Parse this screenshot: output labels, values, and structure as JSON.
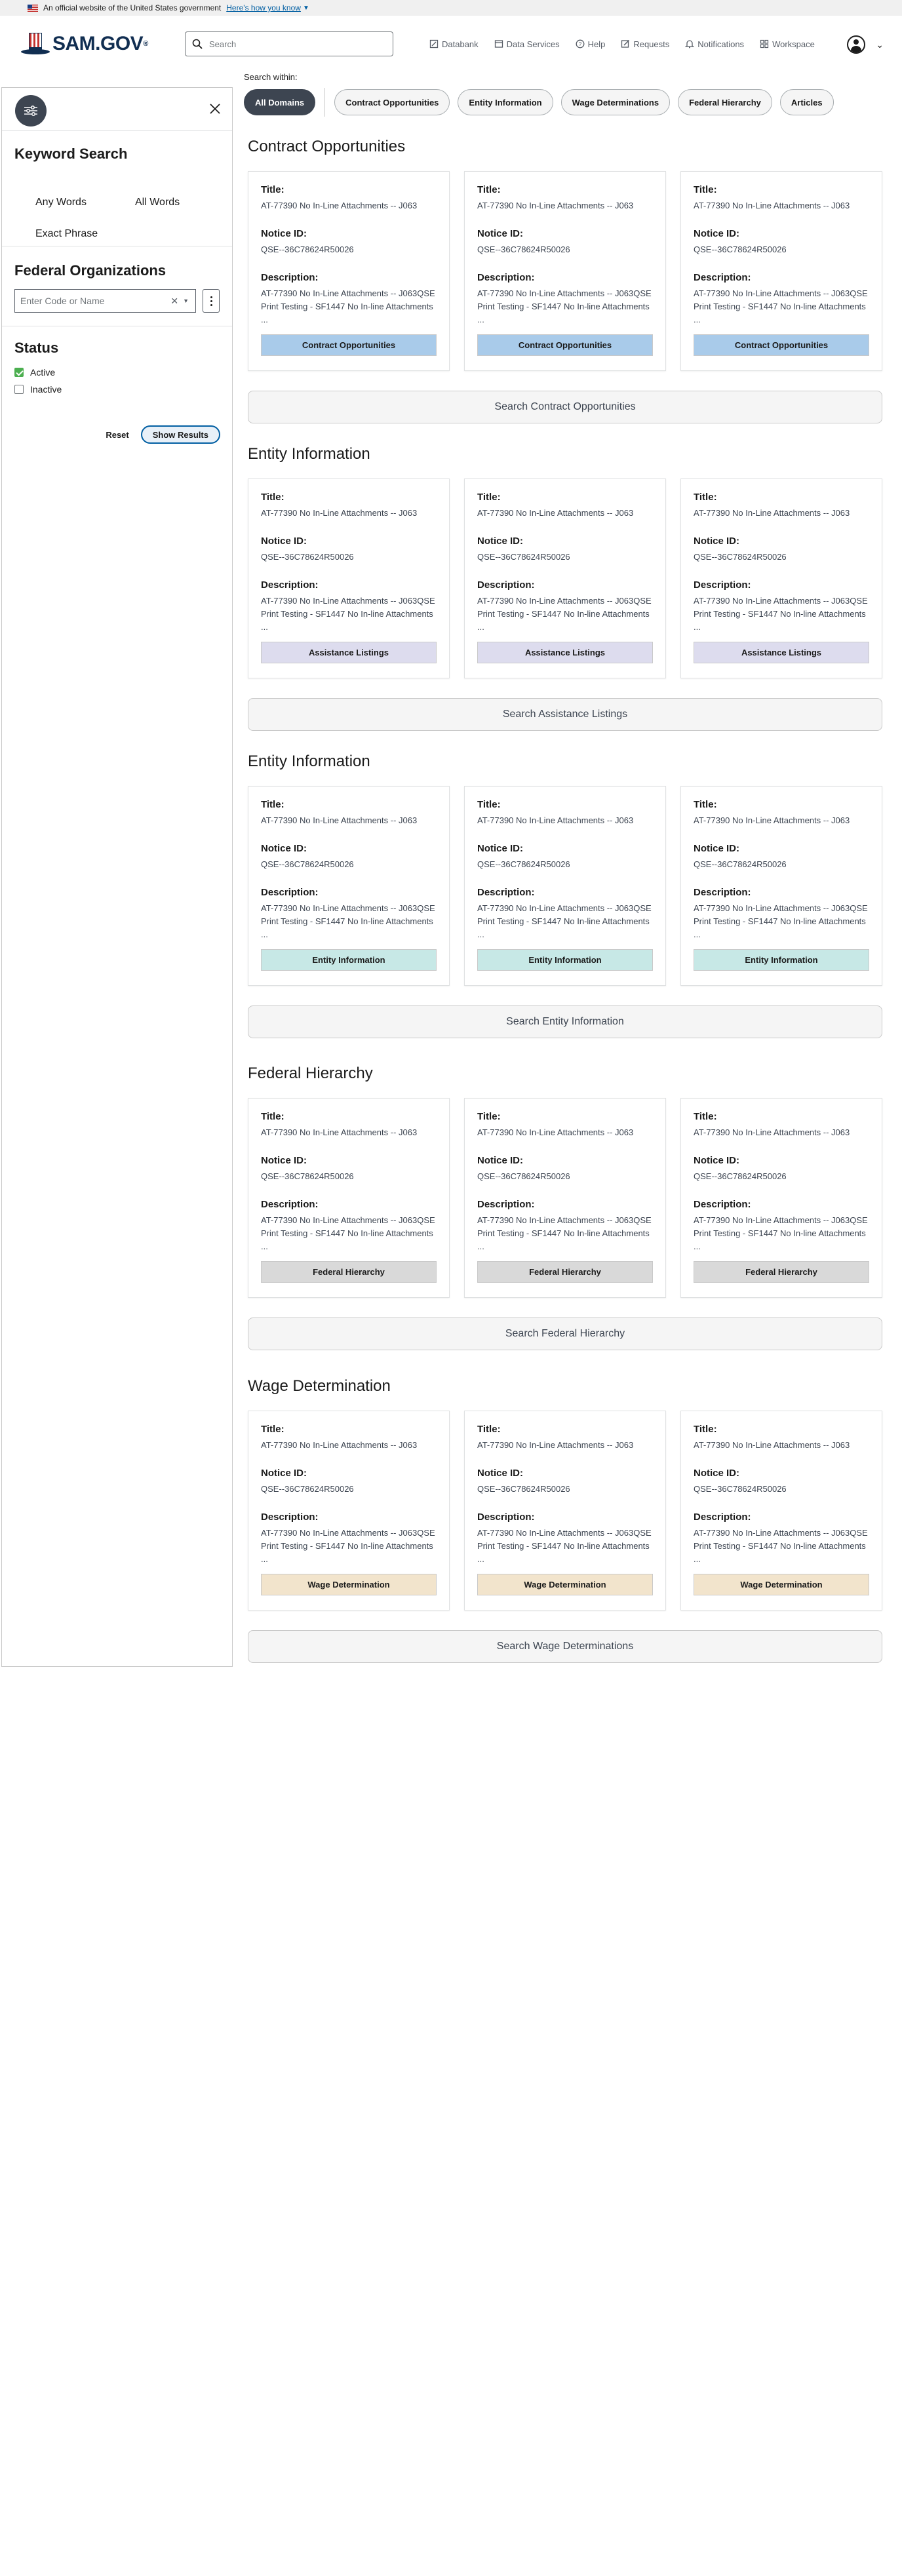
{
  "banner": {
    "text": "An official website of the United States government",
    "link": "Here's how you know"
  },
  "header": {
    "logo": "SAM.GOV",
    "search_placeholder": "Search",
    "nav": [
      {
        "label": "Databank",
        "icon": "databank-icon"
      },
      {
        "label": "Data Services",
        "icon": "data-services-icon"
      },
      {
        "label": "Help",
        "icon": "help-icon"
      },
      {
        "label": "Requests",
        "icon": "requests-icon"
      },
      {
        "label": "Notifications",
        "icon": "bell-icon"
      },
      {
        "label": "Workspace",
        "icon": "workspace-icon"
      }
    ]
  },
  "sidebar": {
    "keyword": {
      "title": "Keyword Search",
      "options": [
        "Any Words",
        "All Words",
        "Exact Phrase"
      ]
    },
    "federal_orgs": {
      "title": "Federal Organizations",
      "placeholder": "Enter Code or Name"
    },
    "status": {
      "title": "Status",
      "options": [
        {
          "label": "Active",
          "checked": true
        },
        {
          "label": "Inactive",
          "checked": false
        }
      ]
    },
    "reset": "Reset",
    "show_results": "Show Results"
  },
  "main": {
    "search_within": "Search within:",
    "domains": [
      "All Domains",
      "Contract Opportunities",
      "Entity Information",
      "Wage Determinations",
      "Federal Hierarchy",
      "Articles"
    ],
    "card_labels": {
      "title": "Title:",
      "notice": "Notice ID:",
      "desc": "Description:"
    },
    "sections": [
      {
        "title": "Contract Opportunities",
        "button_color": "#a9cbea",
        "search_all": "Search Contract Opportunities",
        "cards": [
          {
            "title": "AT-77390 No In-Line Attachments -- J063",
            "notice_id": "QSE--36C78624R50026",
            "description": "AT-77390 No In-Line Attachments -- J063QSE Print Testing - SF1447 No In-line Attachments ...",
            "button": "Contract Opportunities"
          },
          {
            "title": "AT-77390 No In-Line Attachments -- J063",
            "notice_id": "QSE--36C78624R50026",
            "description": "AT-77390 No In-Line Attachments -- J063QSE Print Testing - SF1447 No In-line Attachments ...",
            "button": "Contract Opportunities"
          },
          {
            "title": "AT-77390 No In-Line Attachments -- J063",
            "notice_id": "QSE--36C78624R50026",
            "description": "AT-77390 No In-Line Attachments -- J063QSE Print Testing - SF1447 No In-line Attachments ...",
            "button": "Contract Opportunities"
          }
        ]
      },
      {
        "title": "Entity Information",
        "button_color": "#dddcee",
        "search_all": "Search Assistance Listings",
        "cards": [
          {
            "title": "AT-77390 No In-Line Attachments -- J063",
            "notice_id": "QSE--36C78624R50026",
            "description": "AT-77390 No In-Line Attachments -- J063QSE Print Testing - SF1447 No In-line Attachments ...",
            "button": "Assistance Listings"
          },
          {
            "title": "AT-77390 No In-Line Attachments -- J063",
            "notice_id": "QSE--36C78624R50026",
            "description": "AT-77390 No In-Line Attachments -- J063QSE Print Testing - SF1447 No In-line Attachments ...",
            "button": "Assistance Listings"
          },
          {
            "title": "AT-77390 No In-Line Attachments -- J063",
            "notice_id": "QSE--36C78624R50026",
            "description": "AT-77390 No In-Line Attachments -- J063QSE Print Testing - SF1447 No In-line Attachments ...",
            "button": "Assistance Listings"
          }
        ]
      },
      {
        "title": "Entity Information",
        "button_color": "#c7e8e6",
        "search_all": "Search Entity Information",
        "cards": [
          {
            "title": "AT-77390 No In-Line Attachments -- J063",
            "notice_id": "QSE--36C78624R50026",
            "description": "AT-77390 No In-Line Attachments -- J063QSE Print Testing - SF1447 No In-line Attachments ...",
            "button": "Entity Information"
          },
          {
            "title": "AT-77390 No In-Line Attachments -- J063",
            "notice_id": "QSE--36C78624R50026",
            "description": "AT-77390 No In-Line Attachments -- J063QSE Print Testing - SF1447 No In-line Attachments ...",
            "button": "Entity Information"
          },
          {
            "title": "AT-77390 No In-Line Attachments -- J063",
            "notice_id": "QSE--36C78624R50026",
            "description": "AT-77390 No In-Line Attachments -- J063QSE Print Testing - SF1447 No In-line Attachments ...",
            "button": "Entity Information"
          }
        ]
      },
      {
        "title": "Federal Hierarchy",
        "button_color": "#d9d9d9",
        "search_all": "Search Federal Hierarchy",
        "cards": [
          {
            "title": "AT-77390 No In-Line Attachments -- J063",
            "notice_id": "QSE--36C78624R50026",
            "description": "AT-77390 No In-Line Attachments -- J063QSE Print Testing - SF1447 No In-line Attachments ...",
            "button": "Federal Hierarchy"
          },
          {
            "title": "AT-77390 No In-Line Attachments -- J063",
            "notice_id": "QSE--36C78624R50026",
            "description": "AT-77390 No In-Line Attachments -- J063QSE Print Testing - SF1447 No In-line Attachments ...",
            "button": "Federal Hierarchy"
          },
          {
            "title": "AT-77390 No In-Line Attachments -- J063",
            "notice_id": "QSE--36C78624R50026",
            "description": "AT-77390 No In-Line Attachments -- J063QSE Print Testing - SF1447 No In-line Attachments ...",
            "button": "Federal Hierarchy"
          }
        ]
      },
      {
        "title": "Wage Determination",
        "button_color": "#f2e4cc",
        "search_all": "Search Wage Determinations",
        "cards": [
          {
            "title": "AT-77390 No In-Line Attachments -- J063",
            "notice_id": "QSE--36C78624R50026",
            "description": "AT-77390 No In-Line Attachments -- J063QSE Print Testing - SF1447 No In-line Attachments ...",
            "button": "Wage Determination"
          },
          {
            "title": "AT-77390 No In-Line Attachments -- J063",
            "notice_id": "QSE--36C78624R50026",
            "description": "AT-77390 No In-Line Attachments -- J063QSE Print Testing - SF1447 No In-line Attachments ...",
            "button": "Wage Determination"
          },
          {
            "title": "AT-77390 No In-Line Attachments -- J063",
            "notice_id": "QSE--36C78624R50026",
            "description": "AT-77390 No In-Line Attachments -- J063QSE Print Testing - SF1447 No In-line Attachments ...",
            "button": "Wage Determination"
          }
        ]
      }
    ]
  }
}
